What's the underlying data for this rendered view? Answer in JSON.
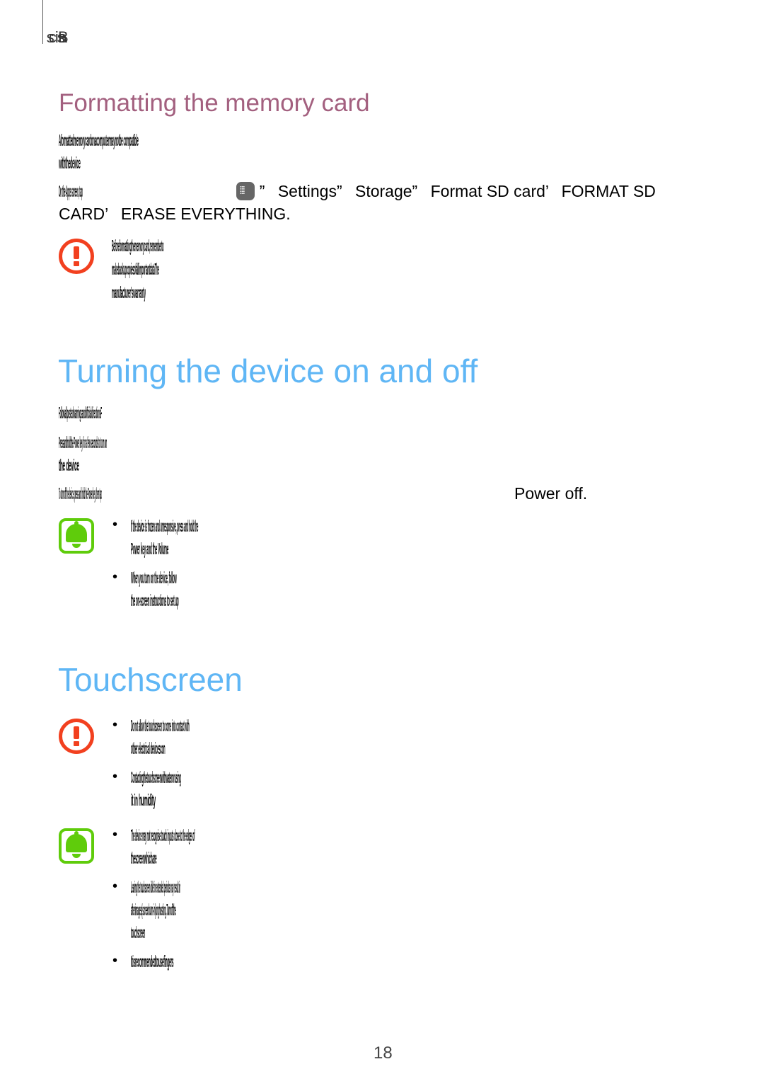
{
  "header": {
    "running_head": "Basics"
  },
  "sections": {
    "formatting": {
      "title": "Formatting the memory card",
      "intro_lines": [
        "Aformattedmemorycardonacomputermaynotbe compatible",
        "withthedevice"
      ],
      "instruction_lead": "On the Apps screen, tap",
      "path": [
        "”",
        "Settings”",
        "Storage”",
        "Format SD card’",
        "FORMAT SD"
      ],
      "path_line2": [
        "CARD’",
        "ERASE EVERYTHING."
      ],
      "warning_lines": [
        "Beforeformattingthememorycard,rememberto",
        "makebackupcopiesofallimportantdataThe",
        "manufacturer'swarranty"
      ]
    },
    "power": {
      "title": "Turning the device on and off",
      "lines": [
        "FollowallpostedwarningsandofficialdirectionsF",
        "Pressandholdthe Power key for a few seconds to turn on",
        "the device",
        "To turn off the device, press and hold the Power key, then tap"
      ],
      "power_off": "Power off.",
      "notes": [
        [
          "If the device is frozen and unresponsive, press and hold the",
          "Power key and the Volume"
        ],
        [
          "When you turn on the device, follow",
          "the on-screen instructions to set up"
        ]
      ]
    },
    "touchscreen": {
      "title": "Touchscreen",
      "warnings": [
        [
          "Do not allow the touchscreen to come into contact with",
          "other electrical devicescon"
        ],
        [
          "Contactingthetouchscreenwithwaterorusing",
          "it in humidity"
        ]
      ],
      "notes": [
        [
          "The device may not recognise touch inputs close to the edges of",
          "thescreenwhichare"
        ],
        [
          "Leaving the touchscreen idle for extended periods may result in",
          "afterimages(screenburn-in)orghosting.Turnoffthe",
          "touchscreen"
        ],
        [
          "Itisrecommendedtousefingers"
        ]
      ]
    }
  },
  "footer": {
    "page_number": "18"
  },
  "colors": {
    "subtitle": "#a3607f",
    "heading": "#5fb6f5",
    "warning": "#f2401f",
    "note": "#5fcc0b"
  }
}
